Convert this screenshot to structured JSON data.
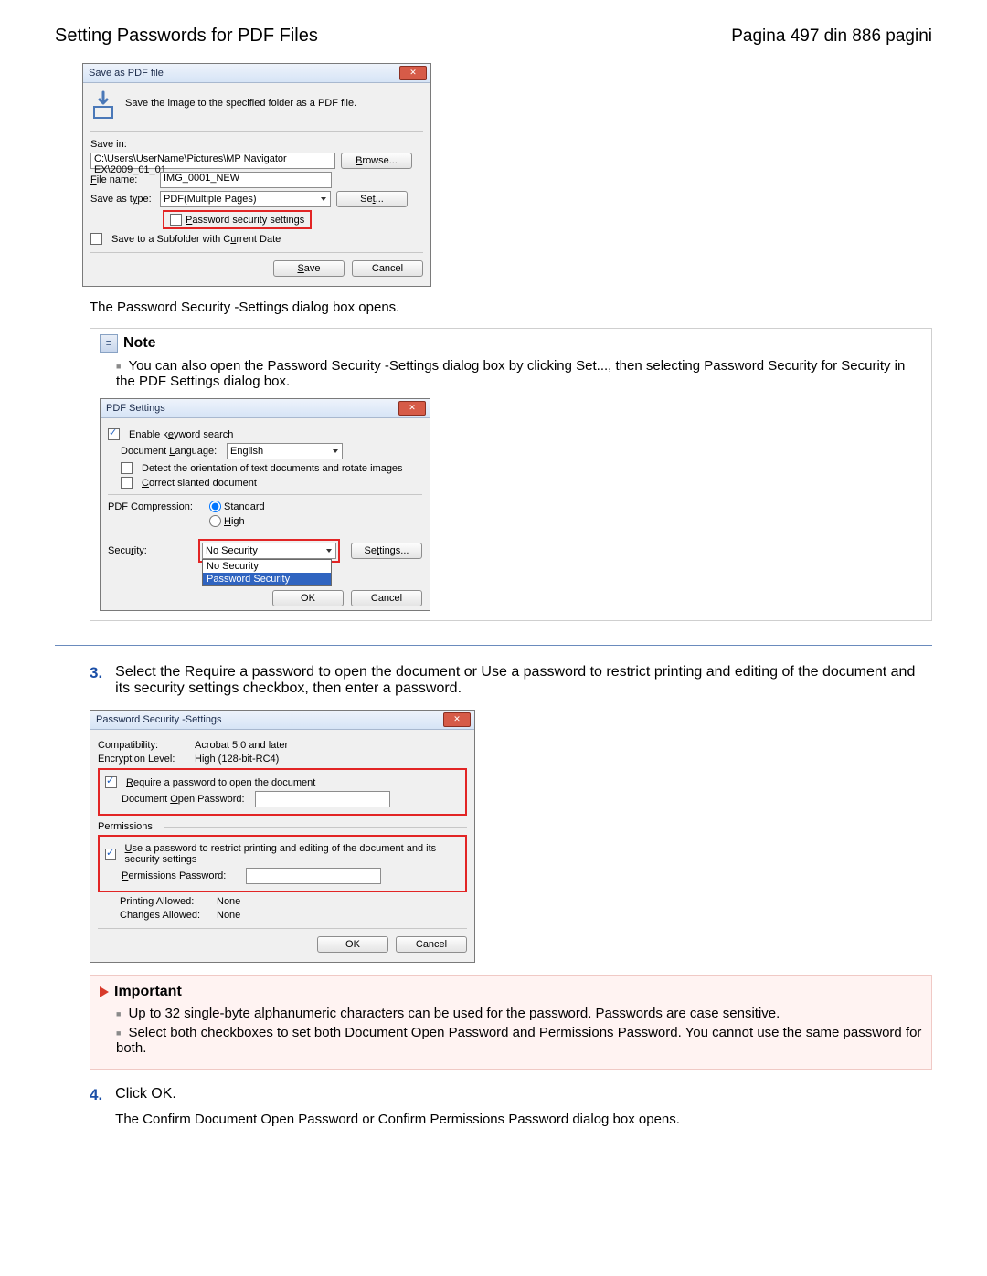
{
  "header": {
    "title": "Setting Passwords for PDF Files",
    "page_info": "Pagina 497 din 886 pagini"
  },
  "dialog1": {
    "title": "Save as PDF file",
    "desc": "Save the image to the specified folder as a PDF file.",
    "save_in_label": "Save in:",
    "save_in_value": "C:\\Users\\UserName\\Pictures\\MP Navigator EX\\2009_01_01",
    "browse": "Browse...",
    "file_name_label": "File name:",
    "file_name_value": "IMG_0001_NEW",
    "save_type_label": "Save as type:",
    "save_type_value": "PDF(Multiple Pages)",
    "set": "Set...",
    "pw_settings": "Password security settings",
    "subfolder": "Save to a Subfolder with Current Date",
    "save": "Save",
    "cancel": "Cancel"
  },
  "after_dialog1": "The Password Security -Settings dialog box opens.",
  "note": {
    "label": "Note",
    "bullet1": "You can also open the Password Security -Settings dialog box by clicking Set..., then selecting Password Security for Security in the PDF Settings dialog box."
  },
  "dialog2": {
    "title": "PDF Settings",
    "enable_kw": "Enable keyword search",
    "doc_lang_label": "Document Language:",
    "doc_lang_value": "English",
    "detect": "Detect the orientation of text documents and rotate images",
    "correct": "Correct slanted document",
    "compression_label": "PDF Compression:",
    "standard": "Standard",
    "high": "High",
    "security_label": "Security:",
    "security_value": "No Security",
    "settings": "Settings...",
    "dd_no_security": "No Security",
    "dd_password_security": "Password Security",
    "ok": "OK",
    "cancel": "Cancel"
  },
  "step3": {
    "num": "3.",
    "text": "Select the Require a password to open the document or Use a password to restrict printing and editing of the document and its security settings checkbox, then enter a password."
  },
  "dialog3": {
    "title": "Password Security -Settings",
    "compat_label": "Compatibility:",
    "compat_value": "Acrobat 5.0 and later",
    "enc_label": "Encryption Level:",
    "enc_value": "High (128-bit-RC4)",
    "require": "Require a password to open the document",
    "doc_open_pw": "Document Open Password:",
    "permissions": "Permissions",
    "use_pw": "Use a password to restrict printing and editing of the document and its security settings",
    "perm_pw": "Permissions Password:",
    "print_label": "Printing Allowed:",
    "print_value": "None",
    "changes_label": "Changes Allowed:",
    "changes_value": "None",
    "ok": "OK",
    "cancel": "Cancel"
  },
  "important": {
    "label": "Important",
    "b1": "Up to 32 single-byte alphanumeric characters can be used for the password. Passwords are case sensitive.",
    "b2": "Select both checkboxes to set both Document Open Password and Permissions Password. You cannot use the same password for both."
  },
  "step4": {
    "num": "4.",
    "text": "Click OK.",
    "sub": "The Confirm Document Open Password or Confirm Permissions Password dialog box opens."
  }
}
